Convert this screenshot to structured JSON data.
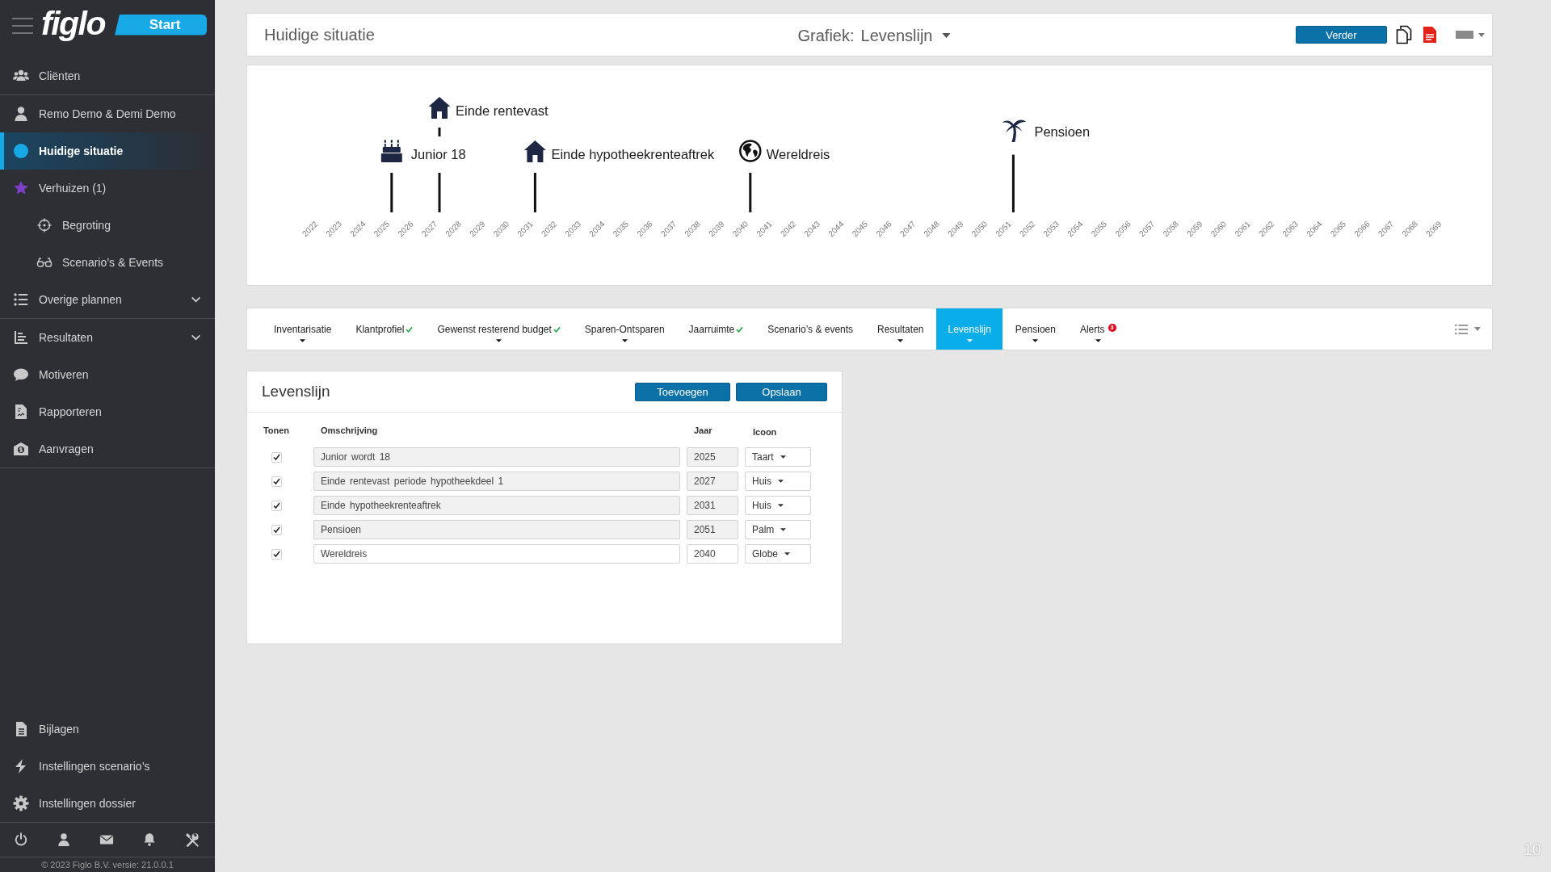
{
  "sidebar": {
    "logo": "figlo",
    "start_button": "Start",
    "sections": [
      {
        "items": [
          {
            "label": "Cliënten",
            "selected": false
          }
        ]
      },
      {
        "items": [
          {
            "label": "Remo Demo & Demi Demo",
            "selected": false
          },
          {
            "label": "Huidige situatie",
            "selected": true
          },
          {
            "label": "Verhuizen (1)",
            "selected": false,
            "children": [
              {
                "label": "Begroting",
                "selected": false
              },
              {
                "label": "Scenario’s & Events",
                "selected": false
              }
            ]
          },
          {
            "label": "Overige plannen",
            "selected": false,
            "expanded": false
          }
        ]
      },
      {
        "items": [
          {
            "label": "Resultaten",
            "selected": false,
            "expanded": false
          },
          {
            "label": "Motiveren",
            "selected": false
          },
          {
            "label": "Rapporteren",
            "selected": false
          },
          {
            "label": "Aanvragen",
            "selected": false
          }
        ]
      }
    ],
    "bottom_items": [
      {
        "label": "Bijlagen",
        "selected": false
      },
      {
        "label": "Instellingen scenario’s",
        "selected": false
      },
      {
        "label": "Instellingen dossier",
        "selected": false
      }
    ],
    "footer": "© 2023 Figlo B.V. versie: 21.0.0.1"
  },
  "header": {
    "title": "Huidige situatie",
    "chart_label": "Grafiek:",
    "chart_value": "Levenslijn",
    "next_button": "Verder"
  },
  "timeline": {
    "ticks": [
      {
        "year": "2022"
      },
      {
        "year": "2023"
      },
      {
        "year": "2024"
      },
      {
        "year": "2025",
        "events": [
          {
            "label": "Junior 18",
            "kind": "cake",
            "raised": false
          }
        ]
      },
      {
        "year": "2026"
      },
      {
        "year": "2027",
        "events": [
          {
            "label": "Einde rentevast",
            "kind": "house",
            "raised": true
          }
        ]
      },
      {
        "year": "2028"
      },
      {
        "year": "2029"
      },
      {
        "year": "2030"
      },
      {
        "year": "2031",
        "events": [
          {
            "label": "Einde hypotheekrenteaftrek",
            "kind": "house",
            "raised": false
          }
        ]
      },
      {
        "year": "2032"
      },
      {
        "year": "2033"
      },
      {
        "year": "2034"
      },
      {
        "year": "2035"
      },
      {
        "year": "2036"
      },
      {
        "year": "2037"
      },
      {
        "year": "2038"
      },
      {
        "year": "2039"
      },
      {
        "year": "2040",
        "events": [
          {
            "label": "Wereldreis",
            "kind": "globe",
            "raised": false
          }
        ]
      },
      {
        "year": "2041"
      },
      {
        "year": "2042"
      },
      {
        "year": "2043"
      },
      {
        "year": "2044"
      },
      {
        "year": "2045"
      },
      {
        "year": "2046"
      },
      {
        "year": "2047"
      },
      {
        "year": "2048"
      },
      {
        "year": "2049"
      },
      {
        "year": "2050"
      },
      {
        "year": "2051",
        "events": [
          {
            "label": "Pensioen",
            "kind": "palm",
            "raised": false
          }
        ]
      },
      {
        "year": "2052"
      },
      {
        "year": "2053"
      },
      {
        "year": "2054"
      },
      {
        "year": "2055"
      },
      {
        "year": "2056"
      },
      {
        "year": "2057"
      },
      {
        "year": "2058"
      },
      {
        "year": "2059"
      },
      {
        "year": "2060"
      },
      {
        "year": "2061"
      },
      {
        "year": "2062"
      },
      {
        "year": "2063"
      },
      {
        "year": "2064"
      },
      {
        "year": "2065"
      },
      {
        "year": "2066"
      },
      {
        "year": "2067"
      },
      {
        "year": "2068"
      },
      {
        "year": "2069"
      }
    ]
  },
  "tabs": [
    {
      "label": "Inventarisatie",
      "selected": false,
      "done": false,
      "has_menu": true
    },
    {
      "label": "Klantprofiel",
      "selected": false,
      "done": true,
      "has_menu": false
    },
    {
      "label": "Gewenst resterend budget",
      "selected": false,
      "done": true,
      "has_menu": true
    },
    {
      "label": "Sparen-Ontsparen",
      "selected": false,
      "done": false,
      "has_menu": true
    },
    {
      "label": "Jaarruimte",
      "selected": false,
      "done": true,
      "has_menu": false
    },
    {
      "label": "Scenario’s & events",
      "selected": false,
      "done": false,
      "has_menu": false
    },
    {
      "label": "Resultaten",
      "selected": false,
      "done": false,
      "has_menu": true
    },
    {
      "label": "Levenslijn",
      "selected": true,
      "done": false,
      "has_menu": true
    },
    {
      "label": "Pensioen",
      "selected": false,
      "done": false,
      "has_menu": true
    },
    {
      "label": "Alerts",
      "selected": false,
      "done": false,
      "has_menu": true,
      "badge": "3"
    }
  ],
  "editor": {
    "title": "Levenslijn",
    "buttons": [
      "Toevoegen",
      "Opslaan"
    ],
    "columns": [
      "Tonen",
      "Omschrijving",
      "Jaar",
      "Icoon"
    ],
    "rows": [
      {
        "shown": true,
        "description": "Junior wordt 18",
        "year": "2025",
        "icon_value": "Taart",
        "disabled": true
      },
      {
        "shown": true,
        "description": "Einde rentevast periode hypotheekdeel 1",
        "year": "2027",
        "icon_value": "Huis",
        "disabled": true
      },
      {
        "shown": true,
        "description": "Einde hypotheekrenteaftrek",
        "year": "2031",
        "icon_value": "Huis",
        "disabled": true
      },
      {
        "shown": true,
        "description": "Pensioen",
        "year": "2051",
        "icon_value": "Palm",
        "disabled": true
      },
      {
        "shown": true,
        "description": "Wereldreis",
        "year": "2040",
        "icon_value": "Globe",
        "disabled": false
      }
    ]
  },
  "page_number": "10"
}
